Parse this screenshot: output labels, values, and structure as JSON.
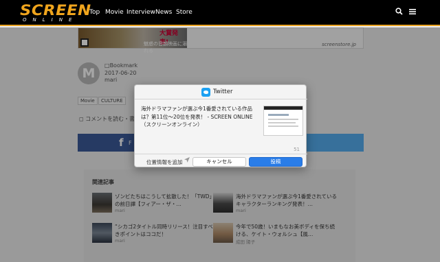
{
  "header": {
    "logo_main": "SCREEN",
    "logo_sub": "ONLINE",
    "nav": [
      "Top",
      "Movie",
      "Interview",
      "News",
      "Store"
    ],
    "search_icon": "search-icon",
    "menu_icon": "hamburger-menu-icon"
  },
  "ad": {
    "badge": "大賞発表!",
    "caption": "魅惑の音韻映画に溺れる",
    "url": "screenstore.jp"
  },
  "article": {
    "avatar_letter": "M",
    "bookmark": "Bookmark",
    "date": "2017-06-20",
    "author": "mari",
    "tags": [
      "Movie",
      "CULTURE"
    ],
    "comments": "コメントを読む・書"
  },
  "share": {
    "facebook_label": "F",
    "colors": {
      "facebook": "#3b5998",
      "twitter": "#55acee"
    }
  },
  "related": {
    "title": "関連記事",
    "items": [
      {
        "text": "ゾンビたちはこうして拡散した！「TWD」の前日譚【フィアー・ザ・…",
        "author": "mari"
      },
      {
        "text": "海外ドラマファンが選ぶ今1番愛されているキャラクターランキング発表！…",
        "author": "mari"
      },
      {
        "text": "“シカゴ2タイトル同時リリース！注目すべきポイントはココだ！",
        "author": "mari"
      },
      {
        "text": "今年で50歳！いまもなお美ボディを保ち続ける、ケイト・ウォルシュ【風…",
        "author": "成田 陽子"
      }
    ]
  },
  "dialog": {
    "title": "Twitter",
    "tweet_text": "海外ドラマファンが選ぶ今1番愛されている作品は？第11位〜20位を発表！ - SCREEN ONLINE（スクリーンオンライン）",
    "char_count": "51",
    "add_location": "位置情報を追加",
    "cancel": "キャンセル",
    "post": "投稿"
  }
}
